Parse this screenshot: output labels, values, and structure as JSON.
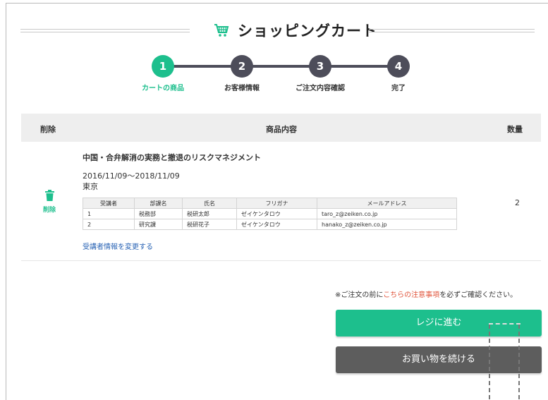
{
  "header": {
    "title": "ショッピングカート",
    "icon": "cart-icon"
  },
  "steps": [
    {
      "num": "1",
      "label": "カートの商品"
    },
    {
      "num": "2",
      "label": "お客様情報"
    },
    {
      "num": "3",
      "label": "ご注文内容確認"
    },
    {
      "num": "4",
      "label": "完了"
    }
  ],
  "table_head": {
    "delete": "削除",
    "content": "商品内容",
    "qty": "数量"
  },
  "item": {
    "delete_label": "削除",
    "name": "中国・合弁解消の実務と撤退のリスクマネジメント",
    "date": "2016/11/09～2018/11/09",
    "location": "東京",
    "quantity": "2",
    "change_link": "受講者情報を変更する",
    "attendee_headers": [
      "受講者",
      "部課名",
      "氏名",
      "フリガナ",
      "メールアドレス"
    ],
    "attendees": [
      [
        "1",
        "税務部",
        "税研太郎",
        "ゼイケンタロウ",
        "taro_z@zeiken.co.jp"
      ],
      [
        "2",
        "研究課",
        "税研花子",
        "ゼイケンタロウ",
        "hanako_z@zeiken.co.jp"
      ]
    ]
  },
  "notice": {
    "before": "※ご注文の前に",
    "link": "こちらの注意事項",
    "after": "を必ずご確認ください。"
  },
  "buttons": {
    "checkout": "レジに進む",
    "continue": "お買い物を続ける"
  },
  "colors": {
    "accent": "#1dbf8d",
    "dark": "#4d4d5a",
    "link": "#2a64b5",
    "notice_red": "#e0533a"
  }
}
